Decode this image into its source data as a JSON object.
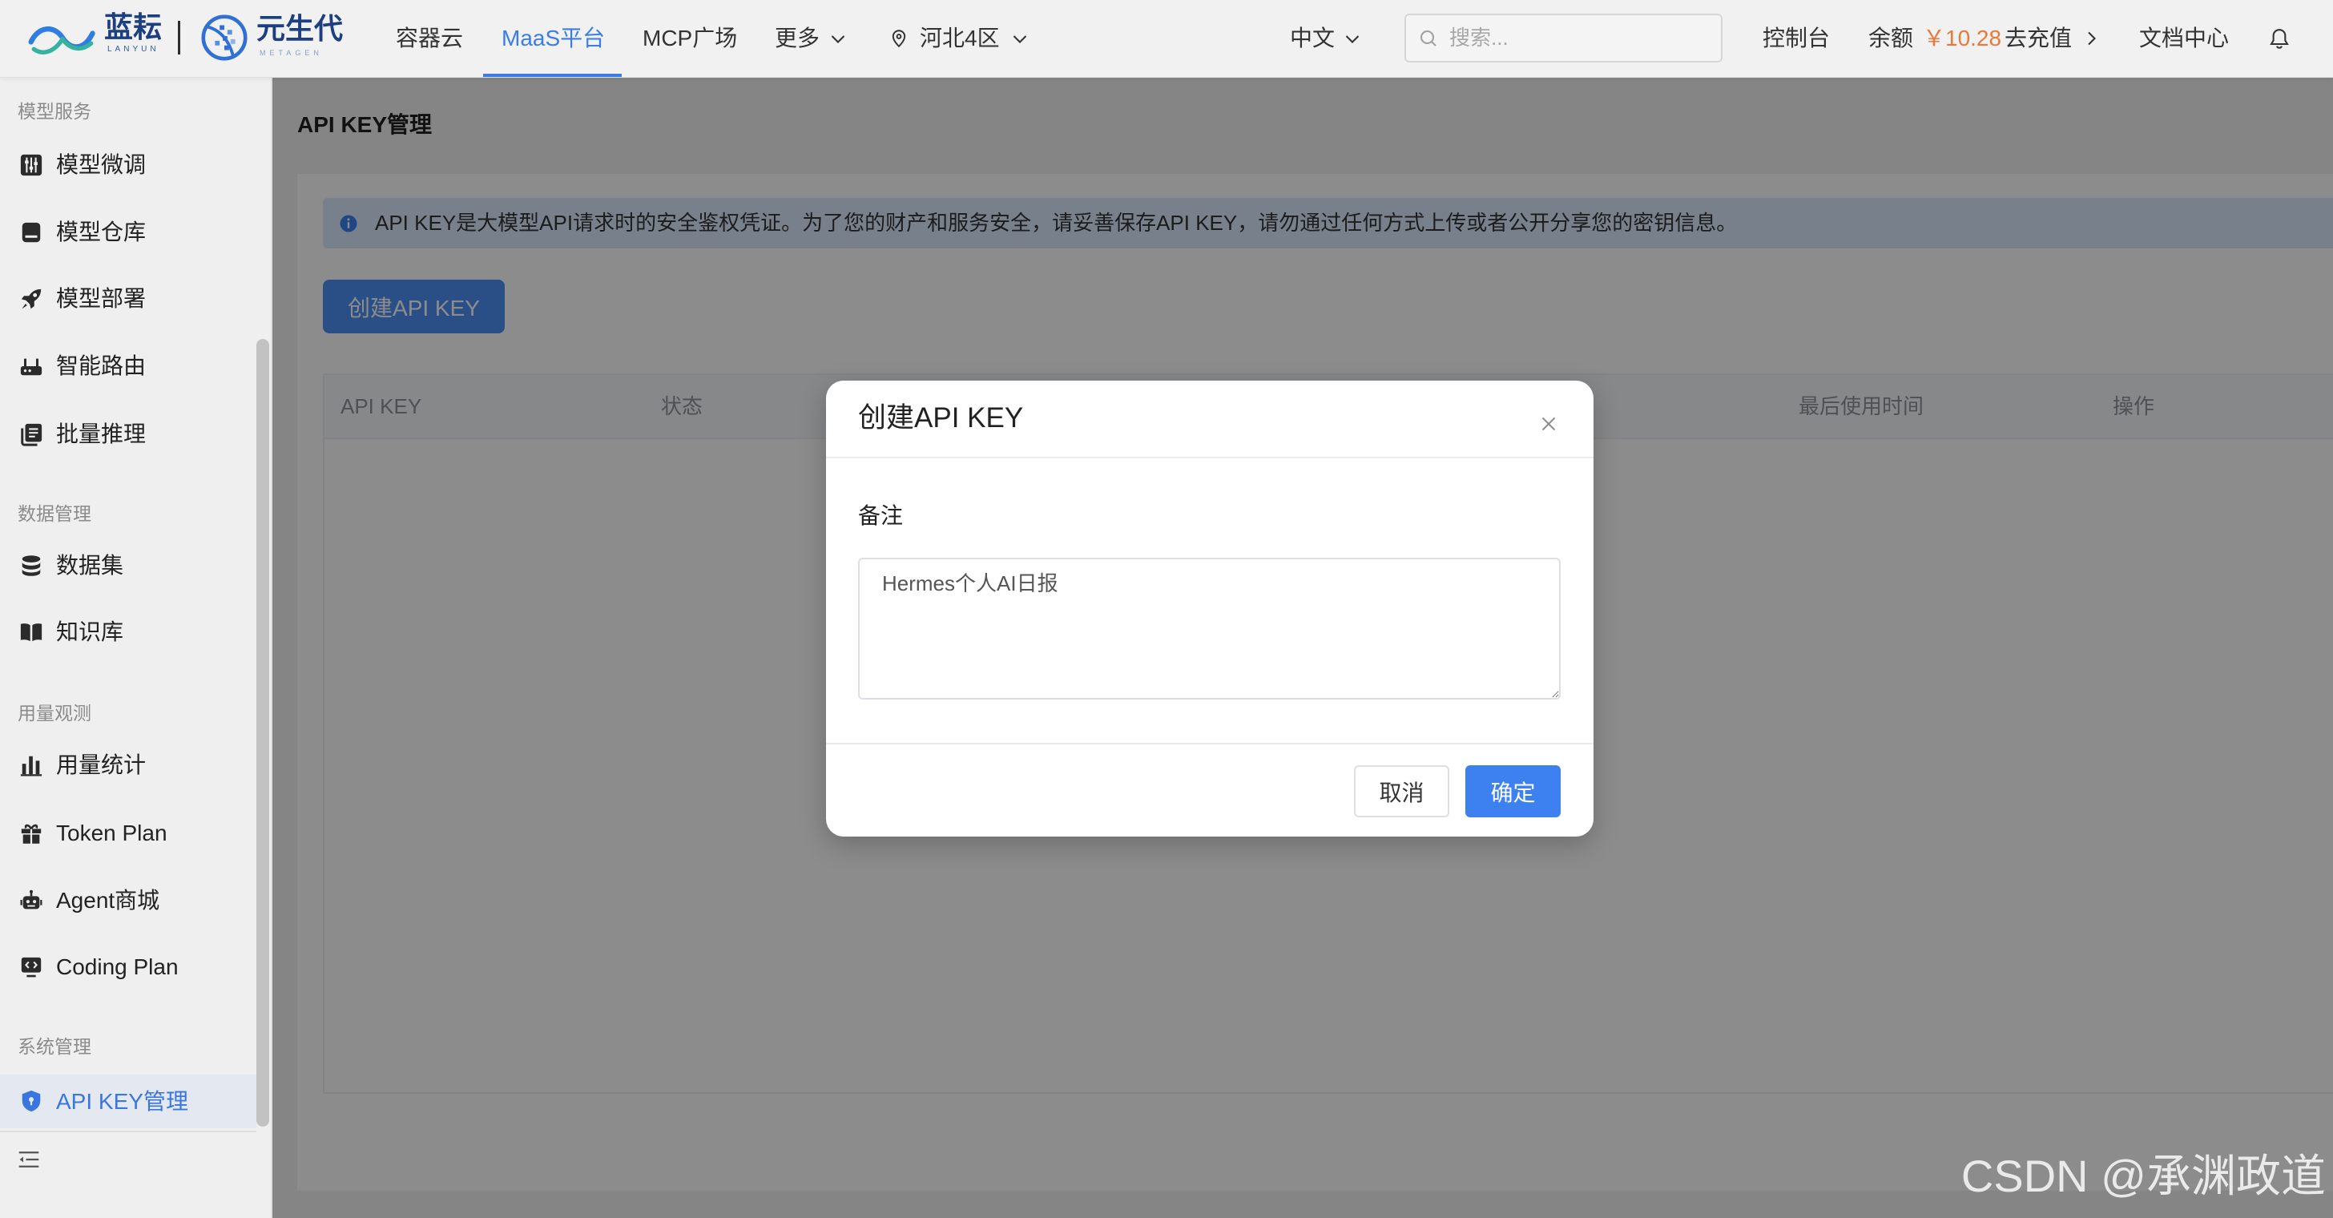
{
  "header": {
    "logo": {
      "brand_cn": "蓝耘",
      "brand_en": "LANYUN",
      "partner_cn": "元生代",
      "partner_en": "METAGEN"
    },
    "nav": [
      {
        "label": "容器云",
        "active": false
      },
      {
        "label": "MaaS平台",
        "active": true
      },
      {
        "label": "MCP广场",
        "active": false
      },
      {
        "label": "更多",
        "active": false
      }
    ],
    "region": "河北4区",
    "language": "中文",
    "search_placeholder": "搜索...",
    "console": "控制台",
    "balance_label": "余额",
    "balance_value": "￥10.28",
    "recharge": "去充值",
    "docs": "文档中心",
    "icons": [
      "location-icon",
      "chevron-down-icon",
      "search-icon",
      "chevron-right-icon",
      "bell-icon"
    ]
  },
  "sidebar": {
    "groups": [
      {
        "label": "模型服务",
        "items": [
          {
            "label": "模型微调",
            "icon": "sliders-icon"
          },
          {
            "label": "模型仓库",
            "icon": "storage-icon"
          },
          {
            "label": "模型部署",
            "icon": "rocket-icon"
          },
          {
            "label": "智能路由",
            "icon": "router-icon"
          },
          {
            "label": "批量推理",
            "icon": "book-list-icon"
          }
        ]
      },
      {
        "label": "数据管理",
        "items": [
          {
            "label": "数据集",
            "icon": "database-icon"
          },
          {
            "label": "知识库",
            "icon": "book-open-icon"
          }
        ]
      },
      {
        "label": "用量观测",
        "items": [
          {
            "label": "用量统计",
            "icon": "bar-chart-icon"
          },
          {
            "label": "Token Plan",
            "icon": "gift-icon"
          },
          {
            "label": "Agent商城",
            "icon": "robot-icon"
          },
          {
            "label": "Coding Plan",
            "icon": "code-monitor-icon"
          }
        ]
      },
      {
        "label": "系统管理",
        "items": [
          {
            "label": "API KEY管理",
            "icon": "shield-icon",
            "active": true
          }
        ]
      }
    ],
    "collapse_icon": "menu-fold-icon"
  },
  "main": {
    "page_title": "API KEY管理",
    "notice": "API KEY是大模型API请求时的安全鉴权凭证。为了您的财产和服务安全，请妥善保存API KEY，请勿通过任何方式上传或者公开分享您的密钥信息。",
    "notice_icon": "info-icon",
    "create_button": "创建API KEY",
    "table": {
      "columns": [
        "API KEY",
        "状态",
        "最后使用时间",
        "操作"
      ],
      "rows": []
    }
  },
  "modal": {
    "title": "创建API KEY",
    "remark_label": "备注",
    "remark_value": "Hermes个人AI日报",
    "cancel": "取消",
    "confirm": "确定",
    "close_icon": "close-icon"
  },
  "watermark": "CSDN @承渊政道",
  "theme": {
    "accent": "#3b7de8",
    "balance": "#e8793a",
    "confirm_button": "#3d80f0",
    "active_menu_bg": "#e4e9f1"
  }
}
